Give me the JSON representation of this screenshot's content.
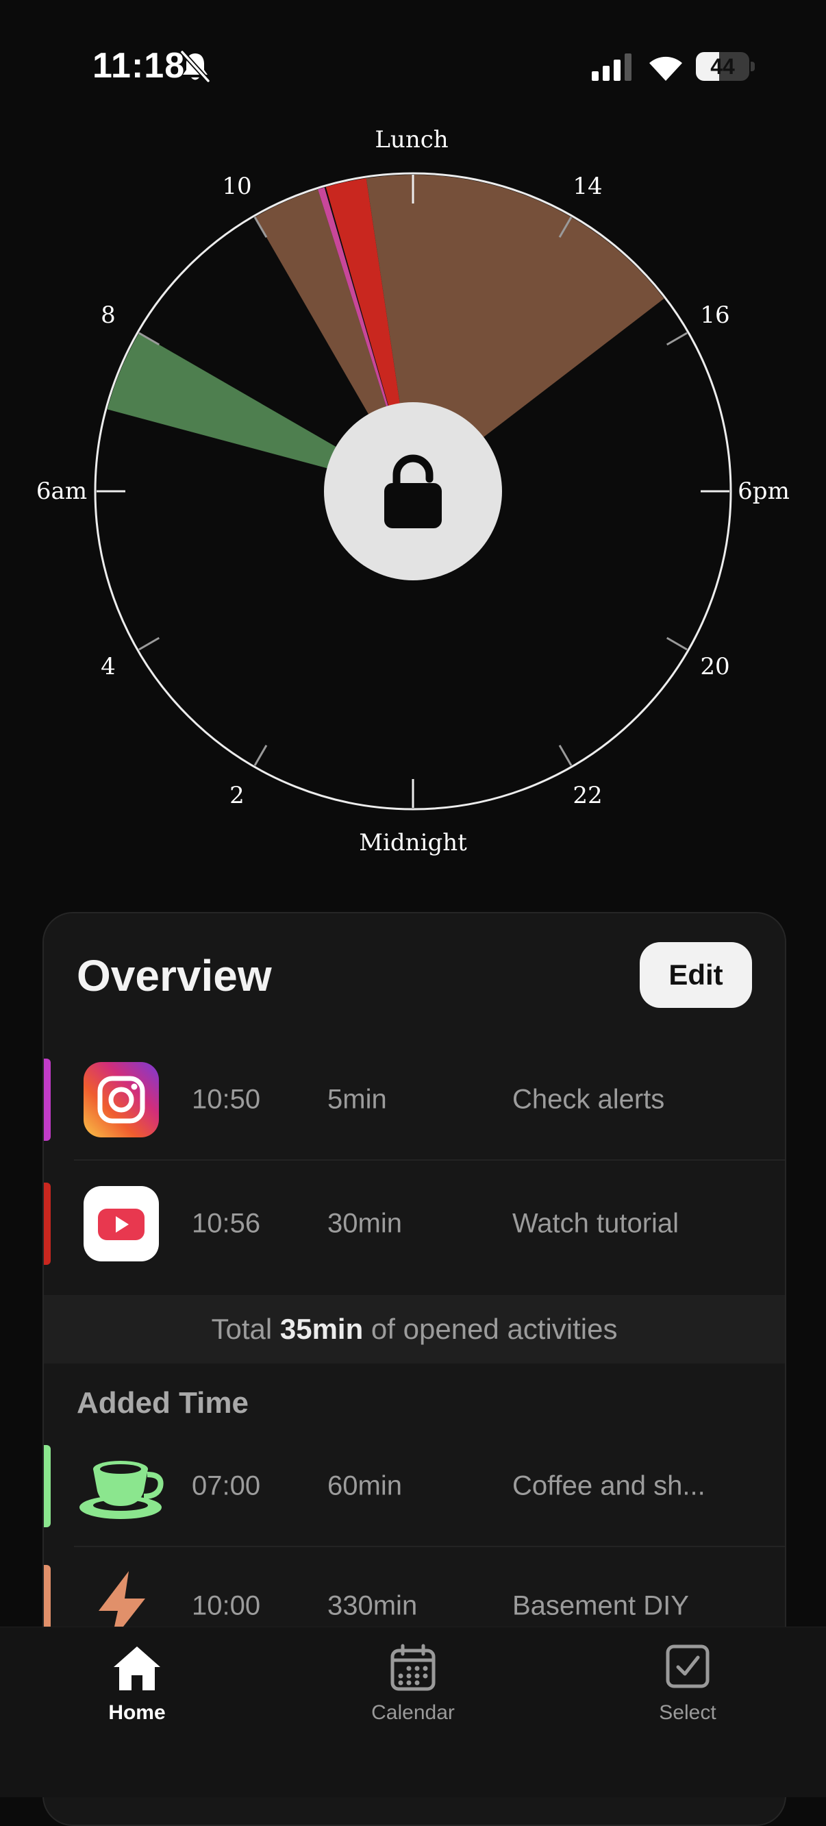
{
  "status_bar": {
    "time": "11:18",
    "battery": "44",
    "battery_level": 0.44
  },
  "clock": {
    "labels": {
      "top": "Lunch",
      "bottom": "Midnight",
      "left": "6am",
      "right": "6pm",
      "h2": "2",
      "h4": "4",
      "h8": "8",
      "h10": "10",
      "h14": "14",
      "h16": "16",
      "h20": "20",
      "h22": "22"
    },
    "segments": [
      {
        "start": "07:00",
        "end": "08:00",
        "color": "#4e7f4f"
      },
      {
        "start": "10:00",
        "end": "10:50",
        "color": "#76503a"
      },
      {
        "start": "10:50",
        "end": "10:55",
        "color": "#c8479a"
      },
      {
        "start": "10:56",
        "end": "11:26",
        "color": "#c9271f"
      },
      {
        "start": "11:26",
        "end": "15:30",
        "color": "#76503a"
      }
    ]
  },
  "overview": {
    "title": "Overview",
    "edit_label": "Edit",
    "opened": [
      {
        "app": "instagram-icon",
        "time": "10:50",
        "duration": "5min",
        "label": "Check alerts",
        "color": "#c23cc8"
      },
      {
        "app": "youtube-icon",
        "time": "10:56",
        "duration": "30min",
        "label": "Watch tutorial",
        "color": "#c9271f"
      }
    ],
    "total_prefix": "Total ",
    "total_value": "35min",
    "total_suffix": " of opened activities",
    "added_title": "Added Time",
    "added": [
      {
        "icon": "coffee-cup-icon",
        "time": "07:00",
        "duration": "60min",
        "label": "Coffee and sh...",
        "color": "#8be68e"
      },
      {
        "icon": "lightning-bolt-icon",
        "time": "10:00",
        "duration": "330min",
        "label": "Basement DIY",
        "color": "#e1906a"
      }
    ]
  },
  "tab_bar": {
    "home": "Home",
    "calendar": "Calendar",
    "select": "Select"
  }
}
